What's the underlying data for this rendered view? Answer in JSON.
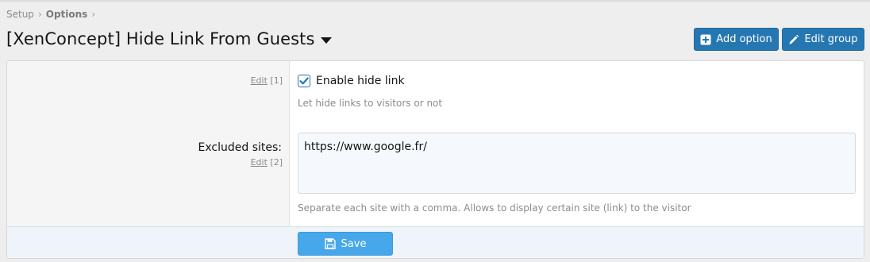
{
  "breadcrumb": {
    "items": [
      "Setup",
      "Options"
    ],
    "separator_icon": "chevron-right-icon"
  },
  "header": {
    "title": "[XenConcept] Hide Link From Guests",
    "caret_icon": "caret-down-icon"
  },
  "buttons": {
    "add_option": {
      "label": "Add option",
      "icon": "plus-square-icon",
      "color": "#2577b1"
    },
    "edit_group": {
      "label": "Edit group",
      "icon": "pencil-icon",
      "color": "#2577b1"
    }
  },
  "options": [
    {
      "label": "",
      "edit_label": "Edit",
      "order": "[1]",
      "checkbox_label": "Enable hide link",
      "checked": true,
      "hint": "Let hide links to visitors or not"
    },
    {
      "label": "Excluded sites:",
      "edit_label": "Edit",
      "order": "[2]",
      "value": "https://www.google.fr/",
      "hint": "Separate each site with a comma. Allows to display certain site (link) to the visitor"
    }
  ],
  "footer": {
    "save_label": "Save",
    "save_icon": "save-icon",
    "save_color": "#47a7eb"
  }
}
